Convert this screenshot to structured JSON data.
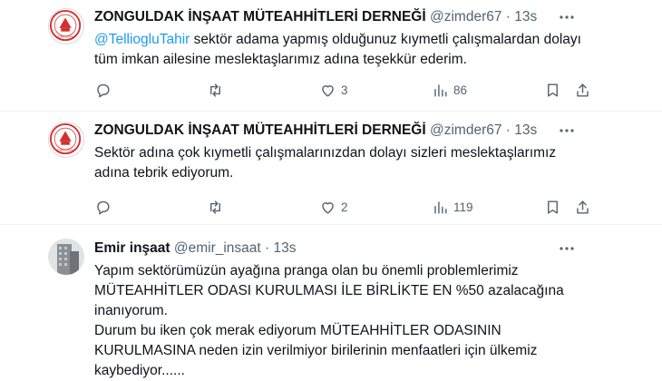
{
  "tweets": [
    {
      "name": "ZONGULDAK İNŞAAT MÜTEAHHİTLERİ DERNEĞİ",
      "handle": "@zimder67",
      "sep": "·",
      "time": "13s",
      "mention": "@TelliogluTahir",
      "text": " sektör adama yapmış olduğunuz kıymetli çalışmalardan dolayı tüm imkan ailesine meslektaşlarımız adına teşekkür ederim.",
      "likes": "3",
      "views": "86",
      "logo_text": "ZONGULDAK"
    },
    {
      "name": "ZONGULDAK İNŞAAT MÜTEAHHİTLERİ DERNEĞİ",
      "handle": "@zimder67",
      "sep": "·",
      "time": "13s",
      "text": "Sektör adına çok kıymetli çalışmalarınızdan dolayı sizleri meslektaşlarımız adına tebrik ediyorum.",
      "likes": "2",
      "views": "119",
      "logo_text": "ZONGULDAK"
    },
    {
      "name": "Emir inşaat",
      "handle": "@emir_insaat",
      "sep": "·",
      "time": "13s",
      "paragraphs": [
        "Yapım sektörümüzün ayağına pranga olan bu önemli problemlerimiz MÜTEAHHİTLER ODASI KURULMASI İLE BİRLİKTE EN %50 azalacağına inanıyorum.",
        "Durum bu iken çok merak ediyorum MÜTEAHHİTLER ODASININ KURULMASINA neden izin verilmiyor birilerinin menfaatleri için ülkemiz kaybediyor......"
      ]
    }
  ],
  "colors": {
    "link": "#1d9bf0",
    "secondary": "#536471",
    "logo_red": "#d32f2f"
  },
  "icons": [
    "reply-icon",
    "retweet-icon",
    "like-icon",
    "views-icon",
    "bookmark-icon",
    "share-icon",
    "more-icon"
  ]
}
